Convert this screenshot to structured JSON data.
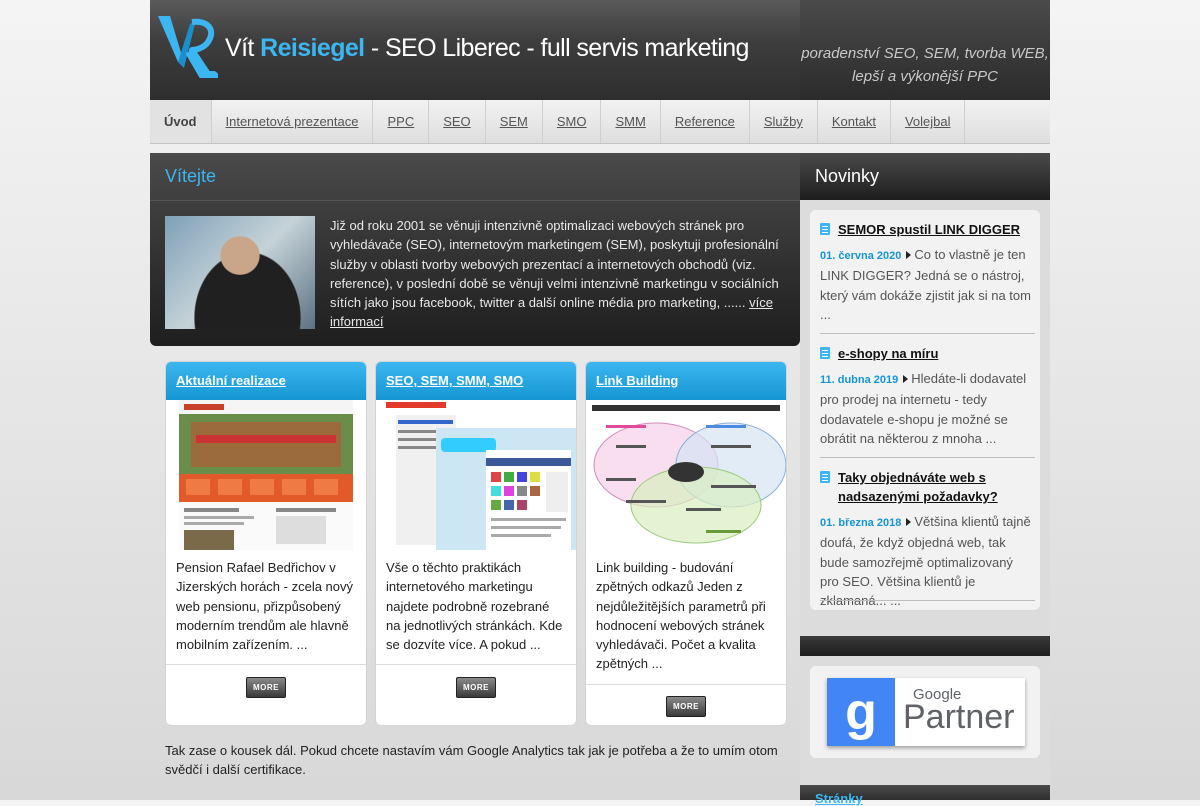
{
  "header": {
    "title_first": "Vít",
    "title_accent": "Reisiegel",
    "title_rest": " - SEO Liberec - full servis marketing",
    "tagline": "poradenství SEO, SEM, tvorba WEB, lepší a výkonější PPC",
    "logo_icon": "vr-logo-icon"
  },
  "nav": {
    "items": [
      "Úvod",
      "Internetová prezentace",
      "PPC",
      "SEO",
      "SEM",
      "SMO",
      "SMM",
      "Reference",
      "Služby",
      "Kontakt",
      "Volejbal"
    ],
    "active": "Úvod"
  },
  "welcome": {
    "title": "Vítejte",
    "text": "Již od roku 2001 se věnuji intenzivně optimalizaci webových stránek pro vyhledávače (SEO), internetovým marketingem (SEM), poskytuji profesionální služby v oblasti tvorby webových prezentací a internetových obchodů (viz. reference), v poslední době se věnuji velmi intenzivně marketingu v sociálních sítích jako jsou facebook, twitter a další online média pro marketing, ...... ",
    "link": "více informací"
  },
  "cards": [
    {
      "title": "Aktuální realizace",
      "text": "Pension Rafael Bedřichov v Jizerských horách  - zcela nový web pensionu, přizpůsobený moderním trendům ale hlavně mobilním zařízením. ...",
      "more": "MORE"
    },
    {
      "title": "SEO, SEM, SMM, SMO",
      "text": "Vše o těchto praktikách internetového marketingu najdete podrobně rozebrané na jednotlivých stránkách. Kde se dozvíte více. A pokud ...",
      "more": "MORE"
    },
    {
      "title": "Link Building",
      "text": "Link building - budování zpětných odkazů Jeden z nejdůležitějších parametrů při hodnocení webových stránek vyhledávači. Počet a kvalita zpětných ...",
      "more": "MORE"
    }
  ],
  "bottom_text": "Tak zase o kousek dál. Pokud chcete nastavím vám Google Analytics tak jak je potřeba a že to umím otom svědčí i další certifikace.",
  "sidebar": {
    "title": "Novinky",
    "news": [
      {
        "title": "SEMOR spustil LINK DIGGER",
        "date": "01. června 2020",
        "text": "Co to vlastně je ten LINK DIGGER? Jedná se o nástroj, který vám dokáže zjistit jak si na tom ..."
      },
      {
        "title": "e-shopy na míru",
        "date": "11. dubna 2019",
        "text": "Hledáte-li dodavatel pro prodej na internetu - tedy dodavatele e-shopu je možné se obrátit na některou z mnoha ..."
      },
      {
        "title": "Taky objednáváte web s nadsazenými požadavky?",
        "date": "01. března 2018",
        "text": "Většina klientů tajně doufá, že když objedná web, tak bude samozřejmě optimalizovaný pro SEO. Většina klientů je zklamaná... ..."
      }
    ],
    "partner": {
      "google": "Google",
      "word": "Partner"
    },
    "bottom_title": "Stránky"
  }
}
